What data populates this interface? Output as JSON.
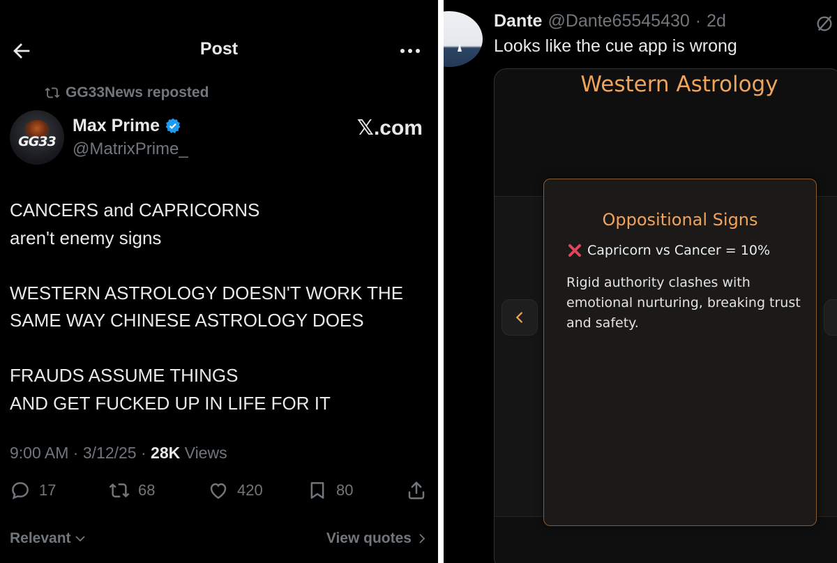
{
  "post": {
    "header": {
      "title": "Post"
    },
    "repost": {
      "label": "GG33News reposted"
    },
    "author": {
      "name": "Max Prime",
      "handle": "@MatrixPrime_",
      "avatar_text": "GG33"
    },
    "source": "𝕏.com",
    "body": [
      "CANCERS and CAPRICORNS",
      "aren't enemy signs",
      "WESTERN ASTROLOGY DOESN'T WORK THE",
      "SAME WAY CHINESE ASTROLOGY DOES",
      "FRAUDS ASSUME THINGS",
      "AND GET FUCKED UP IN LIFE FOR IT"
    ],
    "meta": {
      "time": "9:00 AM",
      "date": "3/12/25",
      "views_count": "28K",
      "views_label": "Views",
      "sep": "·"
    },
    "actions": {
      "replies": "17",
      "reposts": "68",
      "likes": "420",
      "bookmarks": "80"
    },
    "footer": {
      "sort_label": "Relevant",
      "quotes_label": "View quotes"
    },
    "icons": [
      "back-arrow-icon",
      "more-icon",
      "repost-icon",
      "verified-icon",
      "reply-icon",
      "like-icon",
      "bookmark-icon",
      "share-icon",
      "chevron-down-icon",
      "chevron-right-icon"
    ]
  },
  "reply": {
    "name": "Dante",
    "handle": "@Dante65545430",
    "sep": "·",
    "time": "2d",
    "text": "Looks like the cue app is wrong",
    "media": {
      "title": "Western Astrology",
      "card_title": "Oppositional Signs",
      "pair_line": "Capricorn vs Cancer = 10%",
      "description": "Rigid authority clashes with emotional nurturing, breaking trust and safety."
    }
  },
  "colors": {
    "background": "#000000",
    "text": "#e7e9ea",
    "muted": "#71767b",
    "verified": "#1d9bf0",
    "accent_orange": "#f0a35a",
    "cross_red": "#e0455a"
  }
}
